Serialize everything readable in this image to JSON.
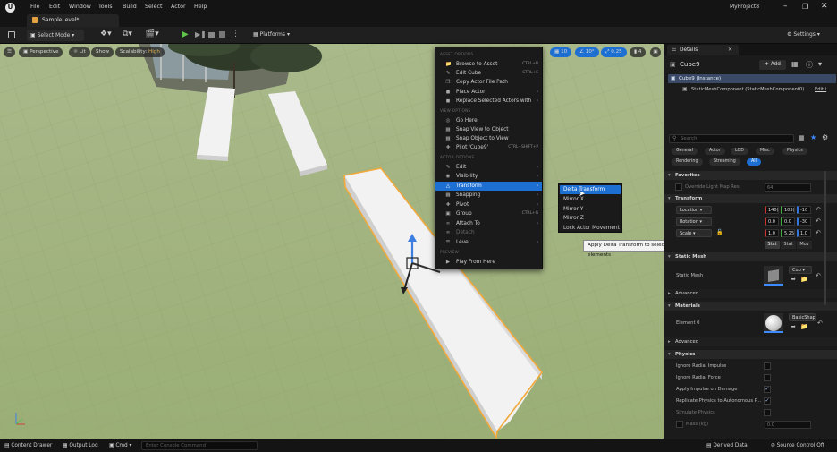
{
  "titlebar": {
    "menus": [
      "File",
      "Edit",
      "Window",
      "Tools",
      "Build",
      "Select",
      "Actor",
      "Help"
    ],
    "project": "MyProject8"
  },
  "tab": {
    "label": "SampleLevel*"
  },
  "toolbar": {
    "select_mode": "Select Mode",
    "platforms": "Platforms",
    "settings": "Settings"
  },
  "viewport": {
    "perspective": "Perspective",
    "lit": "Lit",
    "show": "Show",
    "scalability_label": "Scalability:",
    "scalability_value": "High",
    "grid_snap": "10",
    "angle_snap": "10°",
    "scale_snap": "0.25",
    "camera_speed": "4"
  },
  "context_menu": {
    "sections": {
      "asset": "ASSET OPTIONS",
      "view": "VIEW OPTIONS",
      "actor": "ACTOR OPTIONS",
      "preview": "PREVIEW"
    },
    "items": [
      {
        "label": "Browse to Asset",
        "shortcut": "CTRL+B"
      },
      {
        "label": "Edit Cube",
        "shortcut": "CTRL+E"
      },
      {
        "label": "Copy Actor File Path",
        "shortcut": ""
      },
      {
        "label": "Place Actor",
        "shortcut": ""
      },
      {
        "label": "Replace Selected Actors with",
        "shortcut": ""
      },
      {
        "label": "Go Here",
        "shortcut": ""
      },
      {
        "label": "Snap View to Object",
        "shortcut": ""
      },
      {
        "label": "Snap Object to View",
        "shortcut": ""
      },
      {
        "label": "Pilot 'Cube9'",
        "shortcut": "CTRL+SHIFT+P"
      },
      {
        "label": "Edit",
        "shortcut": ""
      },
      {
        "label": "Visibility",
        "shortcut": ""
      },
      {
        "label": "Transform",
        "shortcut": ""
      },
      {
        "label": "Snapping",
        "shortcut": ""
      },
      {
        "label": "Pivot",
        "shortcut": ""
      },
      {
        "label": "Group",
        "shortcut": "CTRL+G"
      },
      {
        "label": "Attach To",
        "shortcut": ""
      },
      {
        "label": "Detach",
        "shortcut": ""
      },
      {
        "label": "Level",
        "shortcut": ""
      },
      {
        "label": "Play From Here",
        "shortcut": ""
      }
    ]
  },
  "submenu": {
    "items": [
      "Delta Transform",
      "Mirror X",
      "Mirror Y",
      "Mirror Z",
      "Lock Actor Movement"
    ]
  },
  "tooltip": "Apply Delta Transform to selected elements",
  "details": {
    "tab": "Details",
    "actor_name": "Cube9",
    "add_button": "+ Add",
    "instance": "Cube9 (Instance)",
    "component": "StaticMeshComponent (StaticMeshComponent0)",
    "edit_link": "Edit i",
    "search_placeholder": "Search",
    "filters_row1": [
      "General",
      "Actor",
      "LOD",
      "Misc",
      "Physics"
    ],
    "filters_row2": [
      "Rendering",
      "Streaming",
      "All"
    ],
    "favorites": {
      "header": "Favorites",
      "row_label": "Override Light Map Res",
      "row_value": "64"
    },
    "transform": {
      "header": "Transform",
      "location": {
        "label": "Location",
        "x": "140(",
        "y": "103(",
        "z": "-10"
      },
      "rotation": {
        "label": "Rotation",
        "x": "0.0 °",
        "y": "0.0 °",
        "z": "-30"
      },
      "scale": {
        "label": "Scale",
        "x": "1.0",
        "y": "5.25",
        "z": "1.0"
      },
      "mobility": [
        "Stat",
        "Stat",
        "Mov"
      ]
    },
    "static_mesh": {
      "header": "Static Mesh",
      "label": "Static Mesh",
      "value": "Cub"
    },
    "advanced1": "Advanced",
    "materials": {
      "header": "Materials",
      "label": "Element 0",
      "value": "BasicShap"
    },
    "advanced2": "Advanced",
    "physics": {
      "header": "Physics",
      "rows": [
        {
          "label": "Ignore Radial Impulse",
          "checked": false
        },
        {
          "label": "Ignore Radial Force",
          "checked": false
        },
        {
          "label": "Apply Impulse on Damage",
          "checked": true
        },
        {
          "label": "Replicate Physics to Autonomous P...",
          "checked": true
        },
        {
          "label": "Simulate Physics",
          "checked": false
        }
      ],
      "mass_label": "Mass (kg)",
      "mass_value": "0.0"
    }
  },
  "statusbar": {
    "content_drawer": "Content Drawer",
    "output_log": "Output Log",
    "cmd": "Cmd",
    "console_placeholder": "Enter Console Command",
    "derived_data": "Derived Data",
    "source_control": "Source Control Off"
  },
  "colors": {
    "accent": "#1d6fd2",
    "selection": "#f2a93b",
    "grass": "#9db07a"
  }
}
